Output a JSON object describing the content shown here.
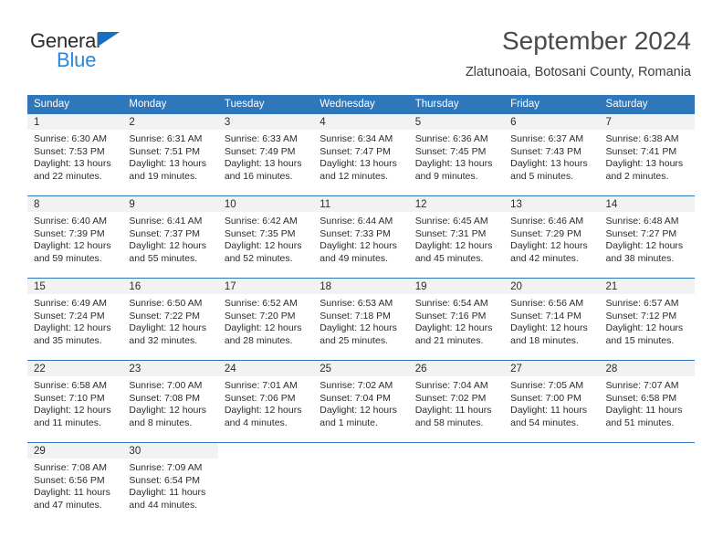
{
  "brand": {
    "line1": "General",
    "line2": "Blue",
    "accent_color": "#2e86d6",
    "triangle_color": "#176fc1"
  },
  "header": {
    "month_title": "September 2024",
    "location": "Zlatunoaia, Botosani County, Romania"
  },
  "calendar": {
    "header_color": "#2e77bb",
    "weekday_headers": [
      "Sunday",
      "Monday",
      "Tuesday",
      "Wednesday",
      "Thursday",
      "Friday",
      "Saturday"
    ],
    "labels": {
      "sunrise_prefix": "Sunrise:",
      "sunset_prefix": "Sunset:",
      "daylight_prefix": "Daylight:"
    },
    "weeks": [
      [
        {
          "day": "1",
          "sunrise": "Sunrise: 6:30 AM",
          "sunset": "Sunset: 7:53 PM",
          "daylight": "Daylight: 13 hours and 22 minutes."
        },
        {
          "day": "2",
          "sunrise": "Sunrise: 6:31 AM",
          "sunset": "Sunset: 7:51 PM",
          "daylight": "Daylight: 13 hours and 19 minutes."
        },
        {
          "day": "3",
          "sunrise": "Sunrise: 6:33 AM",
          "sunset": "Sunset: 7:49 PM",
          "daylight": "Daylight: 13 hours and 16 minutes."
        },
        {
          "day": "4",
          "sunrise": "Sunrise: 6:34 AM",
          "sunset": "Sunset: 7:47 PM",
          "daylight": "Daylight: 13 hours and 12 minutes."
        },
        {
          "day": "5",
          "sunrise": "Sunrise: 6:36 AM",
          "sunset": "Sunset: 7:45 PM",
          "daylight": "Daylight: 13 hours and 9 minutes."
        },
        {
          "day": "6",
          "sunrise": "Sunrise: 6:37 AM",
          "sunset": "Sunset: 7:43 PM",
          "daylight": "Daylight: 13 hours and 5 minutes."
        },
        {
          "day": "7",
          "sunrise": "Sunrise: 6:38 AM",
          "sunset": "Sunset: 7:41 PM",
          "daylight": "Daylight: 13 hours and 2 minutes."
        }
      ],
      [
        {
          "day": "8",
          "sunrise": "Sunrise: 6:40 AM",
          "sunset": "Sunset: 7:39 PM",
          "daylight": "Daylight: 12 hours and 59 minutes."
        },
        {
          "day": "9",
          "sunrise": "Sunrise: 6:41 AM",
          "sunset": "Sunset: 7:37 PM",
          "daylight": "Daylight: 12 hours and 55 minutes."
        },
        {
          "day": "10",
          "sunrise": "Sunrise: 6:42 AM",
          "sunset": "Sunset: 7:35 PM",
          "daylight": "Daylight: 12 hours and 52 minutes."
        },
        {
          "day": "11",
          "sunrise": "Sunrise: 6:44 AM",
          "sunset": "Sunset: 7:33 PM",
          "daylight": "Daylight: 12 hours and 49 minutes."
        },
        {
          "day": "12",
          "sunrise": "Sunrise: 6:45 AM",
          "sunset": "Sunset: 7:31 PM",
          "daylight": "Daylight: 12 hours and 45 minutes."
        },
        {
          "day": "13",
          "sunrise": "Sunrise: 6:46 AM",
          "sunset": "Sunset: 7:29 PM",
          "daylight": "Daylight: 12 hours and 42 minutes."
        },
        {
          "day": "14",
          "sunrise": "Sunrise: 6:48 AM",
          "sunset": "Sunset: 7:27 PM",
          "daylight": "Daylight: 12 hours and 38 minutes."
        }
      ],
      [
        {
          "day": "15",
          "sunrise": "Sunrise: 6:49 AM",
          "sunset": "Sunset: 7:24 PM",
          "daylight": "Daylight: 12 hours and 35 minutes."
        },
        {
          "day": "16",
          "sunrise": "Sunrise: 6:50 AM",
          "sunset": "Sunset: 7:22 PM",
          "daylight": "Daylight: 12 hours and 32 minutes."
        },
        {
          "day": "17",
          "sunrise": "Sunrise: 6:52 AM",
          "sunset": "Sunset: 7:20 PM",
          "daylight": "Daylight: 12 hours and 28 minutes."
        },
        {
          "day": "18",
          "sunrise": "Sunrise: 6:53 AM",
          "sunset": "Sunset: 7:18 PM",
          "daylight": "Daylight: 12 hours and 25 minutes."
        },
        {
          "day": "19",
          "sunrise": "Sunrise: 6:54 AM",
          "sunset": "Sunset: 7:16 PM",
          "daylight": "Daylight: 12 hours and 21 minutes."
        },
        {
          "day": "20",
          "sunrise": "Sunrise: 6:56 AM",
          "sunset": "Sunset: 7:14 PM",
          "daylight": "Daylight: 12 hours and 18 minutes."
        },
        {
          "day": "21",
          "sunrise": "Sunrise: 6:57 AM",
          "sunset": "Sunset: 7:12 PM",
          "daylight": "Daylight: 12 hours and 15 minutes."
        }
      ],
      [
        {
          "day": "22",
          "sunrise": "Sunrise: 6:58 AM",
          "sunset": "Sunset: 7:10 PM",
          "daylight": "Daylight: 12 hours and 11 minutes."
        },
        {
          "day": "23",
          "sunrise": "Sunrise: 7:00 AM",
          "sunset": "Sunset: 7:08 PM",
          "daylight": "Daylight: 12 hours and 8 minutes."
        },
        {
          "day": "24",
          "sunrise": "Sunrise: 7:01 AM",
          "sunset": "Sunset: 7:06 PM",
          "daylight": "Daylight: 12 hours and 4 minutes."
        },
        {
          "day": "25",
          "sunrise": "Sunrise: 7:02 AM",
          "sunset": "Sunset: 7:04 PM",
          "daylight": "Daylight: 12 hours and 1 minute."
        },
        {
          "day": "26",
          "sunrise": "Sunrise: 7:04 AM",
          "sunset": "Sunset: 7:02 PM",
          "daylight": "Daylight: 11 hours and 58 minutes."
        },
        {
          "day": "27",
          "sunrise": "Sunrise: 7:05 AM",
          "sunset": "Sunset: 7:00 PM",
          "daylight": "Daylight: 11 hours and 54 minutes."
        },
        {
          "day": "28",
          "sunrise": "Sunrise: 7:07 AM",
          "sunset": "Sunset: 6:58 PM",
          "daylight": "Daylight: 11 hours and 51 minutes."
        }
      ],
      [
        {
          "day": "29",
          "sunrise": "Sunrise: 7:08 AM",
          "sunset": "Sunset: 6:56 PM",
          "daylight": "Daylight: 11 hours and 47 minutes."
        },
        {
          "day": "30",
          "sunrise": "Sunrise: 7:09 AM",
          "sunset": "Sunset: 6:54 PM",
          "daylight": "Daylight: 11 hours and 44 minutes."
        },
        {
          "day": "",
          "sunrise": "",
          "sunset": "",
          "daylight": ""
        },
        {
          "day": "",
          "sunrise": "",
          "sunset": "",
          "daylight": ""
        },
        {
          "day": "",
          "sunrise": "",
          "sunset": "",
          "daylight": ""
        },
        {
          "day": "",
          "sunrise": "",
          "sunset": "",
          "daylight": ""
        },
        {
          "day": "",
          "sunrise": "",
          "sunset": "",
          "daylight": ""
        }
      ]
    ]
  }
}
